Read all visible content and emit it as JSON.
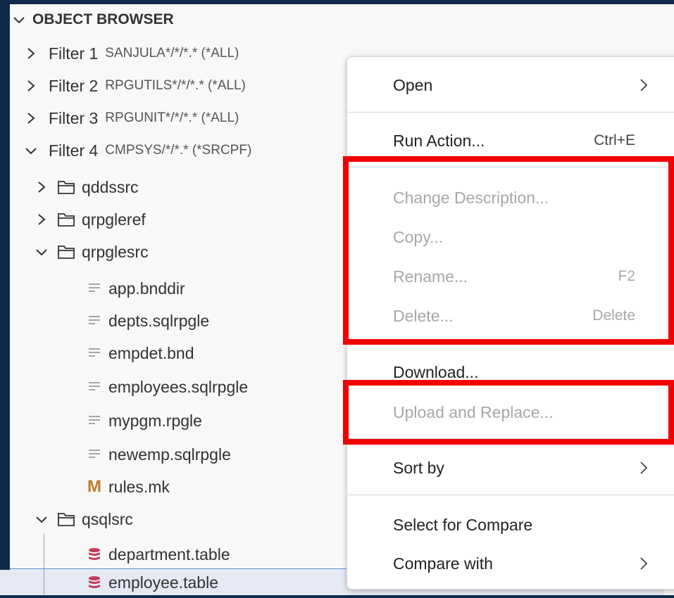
{
  "explorer": {
    "section_title": "OBJECT BROWSER",
    "rows": [
      {
        "label": "Filter 1",
        "desc": "SANJULA*/*/*.* (*ALL)"
      },
      {
        "label": "Filter 2",
        "desc": "RPGUTILS*/*/*.* (*ALL)"
      },
      {
        "label": "Filter 3",
        "desc": "RPGUNIT*/*/*.* (*ALL)"
      },
      {
        "label": "Filter 4",
        "desc": "CMPSYS/*/*.* (*SRCPF)"
      },
      {
        "label": "qddssrc"
      },
      {
        "label": "qrpgleref"
      },
      {
        "label": "qrpglesrc"
      },
      {
        "label": "app.bnddir"
      },
      {
        "label": "depts.sqlrpgle"
      },
      {
        "label": "empdet.bnd"
      },
      {
        "label": "employees.sqlrpgle"
      },
      {
        "label": "mypgm.rpgle"
      },
      {
        "label": "newemp.sqlrpgle"
      },
      {
        "label": "rules.mk",
        "icon_text": "M"
      },
      {
        "label": "qsqlsrc"
      },
      {
        "label": "department.table"
      },
      {
        "label": "employee.table"
      }
    ]
  },
  "context_menu": {
    "items": [
      {
        "label": "Open"
      },
      {
        "label": "Run Action...",
        "key": "Ctrl+E"
      },
      {
        "label": "Change Description..."
      },
      {
        "label": "Copy..."
      },
      {
        "label": "Rename...",
        "key": "F2"
      },
      {
        "label": "Delete...",
        "key": "Delete"
      },
      {
        "label": "Download..."
      },
      {
        "label": "Upload and Replace..."
      },
      {
        "label": "Sort by"
      },
      {
        "label": "Select for Compare"
      },
      {
        "label": "Compare with"
      }
    ]
  },
  "colors": {
    "highlight_box": "#f00000",
    "frame": "#0f2a4a",
    "selection": "#e4e9f4"
  }
}
